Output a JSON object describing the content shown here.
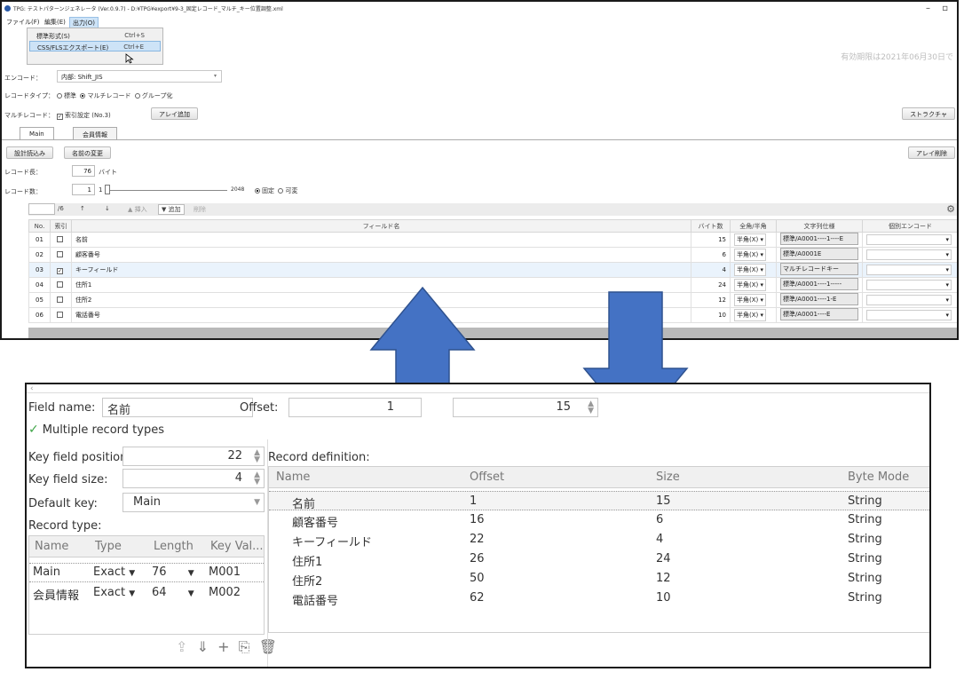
{
  "top_window": {
    "title": "TPG: テストパターンジェネレータ (Ver.0.9.7) - D:¥TPG¥export¥9-3_固定レコード_マルチ_キー位置調整.xml",
    "menu": [
      "ファイル(F)",
      "編集(E)",
      "出力(O)"
    ],
    "dropdown": [
      {
        "label": "標準形式(S)",
        "shortcut": "Ctrl+S"
      },
      {
        "label": "CSS/FLSエクスポート(E)",
        "shortcut": "Ctrl+E"
      }
    ],
    "expiry": "有効期限は2021年06月30日で",
    "encode_label": "エンコード：",
    "encode_value": "内部: Shift_JIS",
    "record_type_label": "レコードタイプ：",
    "record_type_options": [
      "標準",
      "マルチレコード",
      "グループ化"
    ],
    "multi_label": "マルチレコード：",
    "multi_check": "索引設定 (No.3)",
    "array_add": "アレイ追加",
    "structure_btn": "ストラクチャ",
    "tabs": [
      "Main",
      "会員情報"
    ],
    "design_load": "設計読込み",
    "rename": "名前の変更",
    "array_delete": "アレイ削除",
    "record_len_label": "レコード長：",
    "record_len_value": "76",
    "record_len_unit": "バイト",
    "record_count_label": "レコード数：",
    "record_count_value": "1",
    "slider_min": "1",
    "slider_max": "2048",
    "count_options": [
      "固定",
      "可変"
    ],
    "page_total": "/6",
    "toolbar": [
      "↑",
      "↓",
      "▲ 挿入",
      "▼ 追加",
      "削除"
    ],
    "columns": [
      "No.",
      "索引",
      "フィールド名",
      "バイト数",
      "全角/半角",
      "文字列仕様",
      "個別エンコード"
    ],
    "rows": [
      {
        "no": "01",
        "idx": false,
        "name": "名前",
        "bytes": "15",
        "width": "半角(X)",
        "spec": "標準/A0001----1----E"
      },
      {
        "no": "02",
        "idx": false,
        "name": "顧客番号",
        "bytes": "6",
        "width": "半角(X)",
        "spec": "標準/A0001E"
      },
      {
        "no": "03",
        "idx": true,
        "name": "キーフィールド",
        "bytes": "4",
        "width": "半角(X)",
        "spec": "マルチレコードキー"
      },
      {
        "no": "04",
        "idx": false,
        "name": "住所1",
        "bytes": "24",
        "width": "半角(X)",
        "spec": "標準/A0001----1-----"
      },
      {
        "no": "05",
        "idx": false,
        "name": "住所2",
        "bytes": "12",
        "width": "半角(X)",
        "spec": "標準/A0001----1-E"
      },
      {
        "no": "06",
        "idx": false,
        "name": "電話番号",
        "bytes": "10",
        "width": "半角(X)",
        "spec": "標準/A0001----E"
      }
    ]
  },
  "bottom_window": {
    "field_name_label": "Field name:",
    "field_name_value": "名前",
    "offset_label": "Offset:",
    "offset_value": "1",
    "size_value": "15",
    "multiple_types": "Multiple record types",
    "key_pos_label": "Key field position:",
    "key_pos_value": "22",
    "key_size_label": "Key field size:",
    "key_size_value": "4",
    "default_key_label": "Default key:",
    "default_key_value": "Main",
    "record_type_label": "Record type:",
    "record_def_label": "Record definition:",
    "rt_columns": [
      "Name",
      "Type",
      "Length",
      "Key Val..."
    ],
    "rt_rows": [
      {
        "name": "Main",
        "type": "Exact",
        "length": "76",
        "key": "M001"
      },
      {
        "name": "会員情報",
        "type": "Exact",
        "length": "64",
        "key": "M002"
      }
    ],
    "rd_columns": [
      "Name",
      "Offset",
      "Size",
      "Byte Mode"
    ],
    "rd_rows": [
      {
        "name": "名前",
        "offset": "1",
        "size": "15",
        "mode": "String"
      },
      {
        "name": "顧客番号",
        "offset": "16",
        "size": "6",
        "mode": "String"
      },
      {
        "name": "キーフィールド",
        "offset": "22",
        "size": "4",
        "mode": "String"
      },
      {
        "name": "住所1",
        "offset": "26",
        "size": "24",
        "mode": "String"
      },
      {
        "name": "住所2",
        "offset": "50",
        "size": "12",
        "mode": "String"
      },
      {
        "name": "電話番号",
        "offset": "62",
        "size": "10",
        "mode": "String"
      }
    ]
  },
  "colors": {
    "arrow_fill": "#4472c4",
    "arrow_stroke": "#2f528f",
    "check_green": "#3fa548"
  }
}
